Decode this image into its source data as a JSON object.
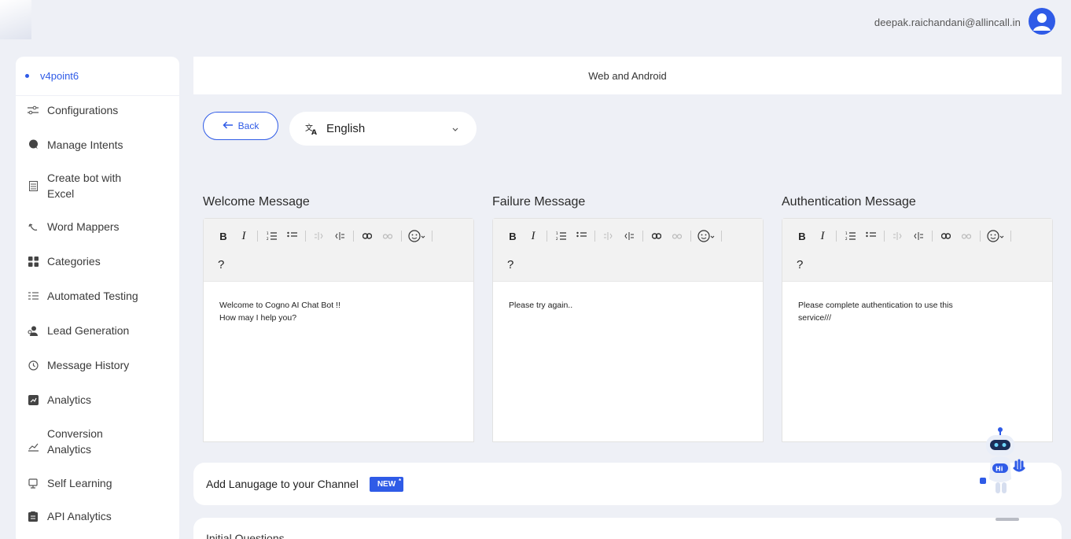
{
  "header": {
    "user_email": "deepak.raichandani@allincall.in"
  },
  "sidebar": {
    "bot_name": "v4point6",
    "items": [
      {
        "label": "Configurations",
        "icon": "sliders-icon"
      },
      {
        "label": "Manage Intents",
        "icon": "chat-icon"
      },
      {
        "label": "Create bot with Excel",
        "icon": "spreadsheet-icon"
      },
      {
        "label": "Word Mappers",
        "icon": "mapper-icon"
      },
      {
        "label": "Categories",
        "icon": "grid-icon"
      },
      {
        "label": "Automated Testing",
        "icon": "checklist-icon"
      },
      {
        "label": "Lead Generation",
        "icon": "people-icon"
      },
      {
        "label": "Message History",
        "icon": "history-icon"
      },
      {
        "label": "Analytics",
        "icon": "analytics-icon"
      },
      {
        "label": "Conversion Analytics",
        "icon": "trend-icon"
      },
      {
        "label": "Self Learning",
        "icon": "learning-icon"
      },
      {
        "label": "API Analytics",
        "icon": "api-icon"
      }
    ]
  },
  "main": {
    "channel_title": "Web and Android",
    "back_label": "Back",
    "language": "English",
    "editors": [
      {
        "title": "Welcome Message",
        "lines": [
          "Welcome to Cogno AI Chat Bot !!",
          "How may I help you?"
        ]
      },
      {
        "title": "Failure Message",
        "lines": [
          "Please try again.."
        ]
      },
      {
        "title": "Authentication Message",
        "lines": [
          "Please complete authentication to use this",
          "service///"
        ]
      }
    ],
    "toolbar": {
      "bold": "B",
      "italic": "I",
      "help": "?"
    },
    "add_language_label": "Add Lanugage to your Channel",
    "new_badge": "NEW",
    "new_badge_star": "*",
    "initial_questions_label": "Initial Questions"
  },
  "colors": {
    "accent": "#2f5be7",
    "background": "#eef0f6"
  }
}
